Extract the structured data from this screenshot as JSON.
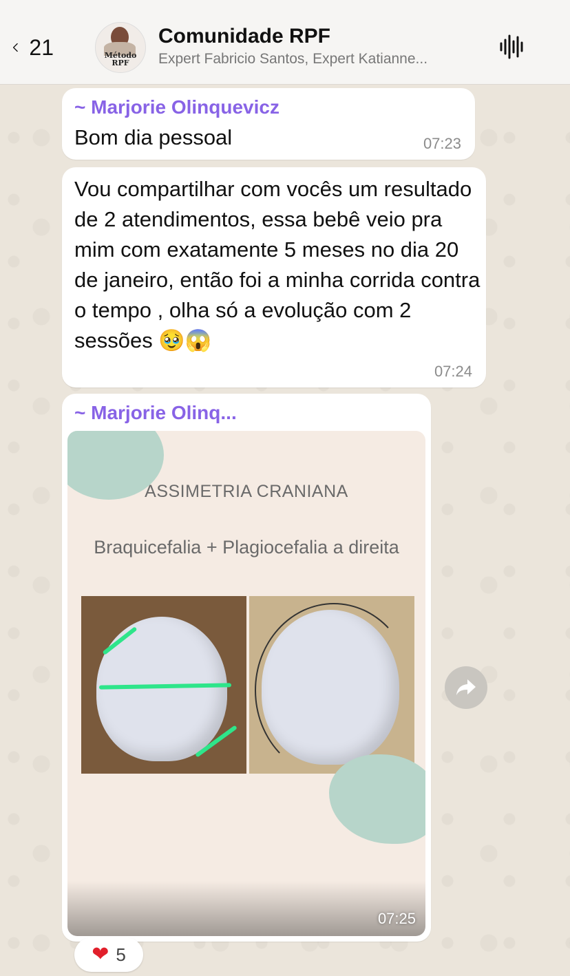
{
  "header": {
    "back_count": "21",
    "group_name": "Comunidade RPF",
    "participants": "Expert Fabricio Santos, Expert Katianne...",
    "avatar_text_line1": "Método",
    "avatar_text_line2": "RPF"
  },
  "messages": [
    {
      "sender": "~ Marjorie Olinquevicz",
      "text": "Bom dia pessoal",
      "time": "07:23"
    },
    {
      "text": "Vou compartilhar com vocês um resultado de 2 atendimentos, essa bebê veio pra mim com exatamente 5 meses no dia 20 de janeiro, então foi a minha corrida contra o tempo , olha só a evolução com 2 sessões 🥹😱",
      "time": "07:24"
    },
    {
      "sender": "~ Marjorie Olinq...",
      "image_heading": "ASSIMETRIA CRANIANA",
      "image_subheading": "Braquicefalia + Plagiocefalia a direita",
      "time": "07:25"
    }
  ],
  "reaction": {
    "emoji": "❤",
    "count": "5"
  },
  "colors": {
    "sender": "#8863e6",
    "header_bg": "#f6f5f3",
    "wallpaper": "#ebe5db"
  },
  "icons": {
    "back": "chevron-left-icon",
    "voice_chat": "waveform-icon",
    "forward": "forward-arrow-icon"
  }
}
